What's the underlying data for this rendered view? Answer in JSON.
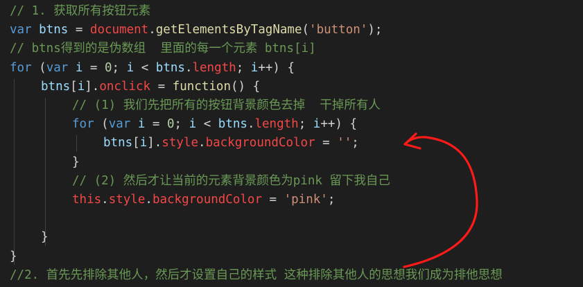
{
  "colors": {
    "background": "#1e1e1e",
    "comment": "#6a9955",
    "keyword": "#569cd6",
    "variable": "#9cdcfe",
    "function": "#dcdcaa",
    "property": "#f44747",
    "string": "#ce9178",
    "number": "#b5cea8",
    "punctuation": "#d4d4d4",
    "annotation_arrow": "#ff1a1a"
  },
  "code_lines": [
    {
      "name": "line-01",
      "indent": 0,
      "tokens": [
        {
          "text": "// 1. 获取所有按钮元素",
          "kind": "comment"
        }
      ]
    },
    {
      "name": "line-02",
      "indent": 0,
      "tokens": [
        {
          "text": "var",
          "kind": "keyword"
        },
        {
          "text": " ",
          "kind": "punctuation"
        },
        {
          "text": "btns",
          "kind": "variable"
        },
        {
          "text": " = ",
          "kind": "punctuation"
        },
        {
          "text": "document",
          "kind": "property"
        },
        {
          "text": ".",
          "kind": "punctuation"
        },
        {
          "text": "getElementsByTagName",
          "kind": "function"
        },
        {
          "text": "(",
          "kind": "punctuation"
        },
        {
          "text": "'button'",
          "kind": "string"
        },
        {
          "text": ");",
          "kind": "punctuation"
        }
      ]
    },
    {
      "name": "line-03",
      "indent": 0,
      "tokens": [
        {
          "text": "// btns得到的是伪数组  里面的每一个元素 btns[i]",
          "kind": "comment"
        }
      ]
    },
    {
      "name": "line-04",
      "indent": 0,
      "tokens": [
        {
          "text": "for",
          "kind": "keyword"
        },
        {
          "text": " (",
          "kind": "punctuation"
        },
        {
          "text": "var",
          "kind": "keyword"
        },
        {
          "text": " ",
          "kind": "punctuation"
        },
        {
          "text": "i",
          "kind": "variable"
        },
        {
          "text": " = ",
          "kind": "punctuation"
        },
        {
          "text": "0",
          "kind": "number"
        },
        {
          "text": "; ",
          "kind": "punctuation"
        },
        {
          "text": "i",
          "kind": "variable"
        },
        {
          "text": " < ",
          "kind": "punctuation"
        },
        {
          "text": "btns",
          "kind": "variable"
        },
        {
          "text": ".",
          "kind": "punctuation"
        },
        {
          "text": "length",
          "kind": "property"
        },
        {
          "text": "; ",
          "kind": "punctuation"
        },
        {
          "text": "i",
          "kind": "variable"
        },
        {
          "text": "++) {",
          "kind": "punctuation"
        }
      ]
    },
    {
      "name": "line-05",
      "indent": 1,
      "tokens": [
        {
          "text": "btns",
          "kind": "variable"
        },
        {
          "text": "[",
          "kind": "punctuation"
        },
        {
          "text": "i",
          "kind": "variable"
        },
        {
          "text": "].",
          "kind": "punctuation"
        },
        {
          "text": "onclick",
          "kind": "property"
        },
        {
          "text": " = ",
          "kind": "punctuation"
        },
        {
          "text": "function",
          "kind": "function"
        },
        {
          "text": "() {",
          "kind": "punctuation"
        }
      ]
    },
    {
      "name": "line-06",
      "indent": 2,
      "tokens": [
        {
          "text": "// (1) 我们先把所有的按钮背景颜色去掉  干掉所有人",
          "kind": "comment"
        }
      ]
    },
    {
      "name": "line-07",
      "indent": 2,
      "tokens": [
        {
          "text": "for",
          "kind": "keyword"
        },
        {
          "text": " (",
          "kind": "punctuation"
        },
        {
          "text": "var",
          "kind": "keyword"
        },
        {
          "text": " ",
          "kind": "punctuation"
        },
        {
          "text": "i",
          "kind": "variable"
        },
        {
          "text": " = ",
          "kind": "punctuation"
        },
        {
          "text": "0",
          "kind": "number"
        },
        {
          "text": "; ",
          "kind": "punctuation"
        },
        {
          "text": "i",
          "kind": "variable"
        },
        {
          "text": " < ",
          "kind": "punctuation"
        },
        {
          "text": "btns",
          "kind": "variable"
        },
        {
          "text": ".",
          "kind": "punctuation"
        },
        {
          "text": "length",
          "kind": "property"
        },
        {
          "text": "; ",
          "kind": "punctuation"
        },
        {
          "text": "i",
          "kind": "variable"
        },
        {
          "text": "++) {",
          "kind": "punctuation"
        }
      ]
    },
    {
      "name": "line-08",
      "indent": 3,
      "tokens": [
        {
          "text": "btns",
          "kind": "variable"
        },
        {
          "text": "[",
          "kind": "punctuation"
        },
        {
          "text": "i",
          "kind": "variable"
        },
        {
          "text": "].",
          "kind": "punctuation"
        },
        {
          "text": "style",
          "kind": "property"
        },
        {
          "text": ".",
          "kind": "punctuation"
        },
        {
          "text": "backgroundColor",
          "kind": "property"
        },
        {
          "text": " = ",
          "kind": "punctuation"
        },
        {
          "text": "''",
          "kind": "string"
        },
        {
          "text": ";",
          "kind": "punctuation"
        }
      ]
    },
    {
      "name": "line-09",
      "indent": 2,
      "tokens": [
        {
          "text": "}",
          "kind": "punctuation"
        }
      ]
    },
    {
      "name": "line-10",
      "indent": 2,
      "tokens": [
        {
          "text": "// (2) 然后才让当前的元素背景颜色为pink 留下我自己",
          "kind": "comment"
        }
      ]
    },
    {
      "name": "line-11",
      "indent": 2,
      "tokens": [
        {
          "text": "this",
          "kind": "property"
        },
        {
          "text": ".",
          "kind": "punctuation"
        },
        {
          "text": "style",
          "kind": "property"
        },
        {
          "text": ".",
          "kind": "punctuation"
        },
        {
          "text": "backgroundColor",
          "kind": "property"
        },
        {
          "text": " = ",
          "kind": "punctuation"
        },
        {
          "text": "'pink'",
          "kind": "string"
        },
        {
          "text": ";",
          "kind": "punctuation"
        }
      ]
    },
    {
      "name": "line-12",
      "indent": 0,
      "tokens": []
    },
    {
      "name": "line-13",
      "indent": 1,
      "tokens": [
        {
          "text": "}",
          "kind": "punctuation"
        }
      ]
    },
    {
      "name": "line-14",
      "indent": 0,
      "tokens": [
        {
          "text": "}",
          "kind": "punctuation"
        }
      ]
    },
    {
      "name": "line-15",
      "indent": 0,
      "tokens": [
        {
          "text": "//2. 首先先排除其他人，然后才设置自己的样式 这种排除其他人的思想我们成为排他思想",
          "kind": "comment"
        }
      ]
    }
  ]
}
